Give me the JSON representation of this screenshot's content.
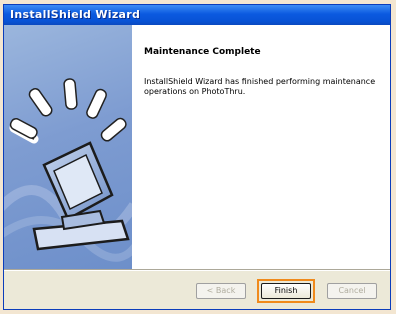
{
  "window": {
    "title": "InstallShield Wizard"
  },
  "content": {
    "heading": "Maintenance Complete",
    "body": "InstallShield Wizard has finished performing maintenance operations on PhotoThru."
  },
  "buttons": {
    "back": "< Back",
    "finish": "Finish",
    "cancel": "Cancel"
  },
  "colors": {
    "title_bar": "#0b5ae0",
    "side_panel": "#7e9cd1",
    "highlight": "#f08a1c"
  }
}
